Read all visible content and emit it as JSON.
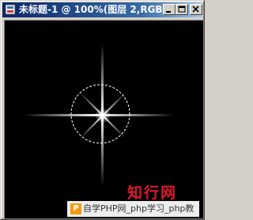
{
  "window": {
    "title": "未标题-1 @ 100%(图层 2,RGB)",
    "buttons": [
      "minimize",
      "maximize",
      "close"
    ]
  },
  "canvas": {
    "background": "#000000",
    "icons": [
      "starburst-icon",
      "circular-marquee-selection"
    ]
  },
  "watermark": {
    "logo_letter": "P",
    "text": "自学PHP网_php学习_php教",
    "brand": "知行网",
    "brand_color": "#e0182d"
  }
}
